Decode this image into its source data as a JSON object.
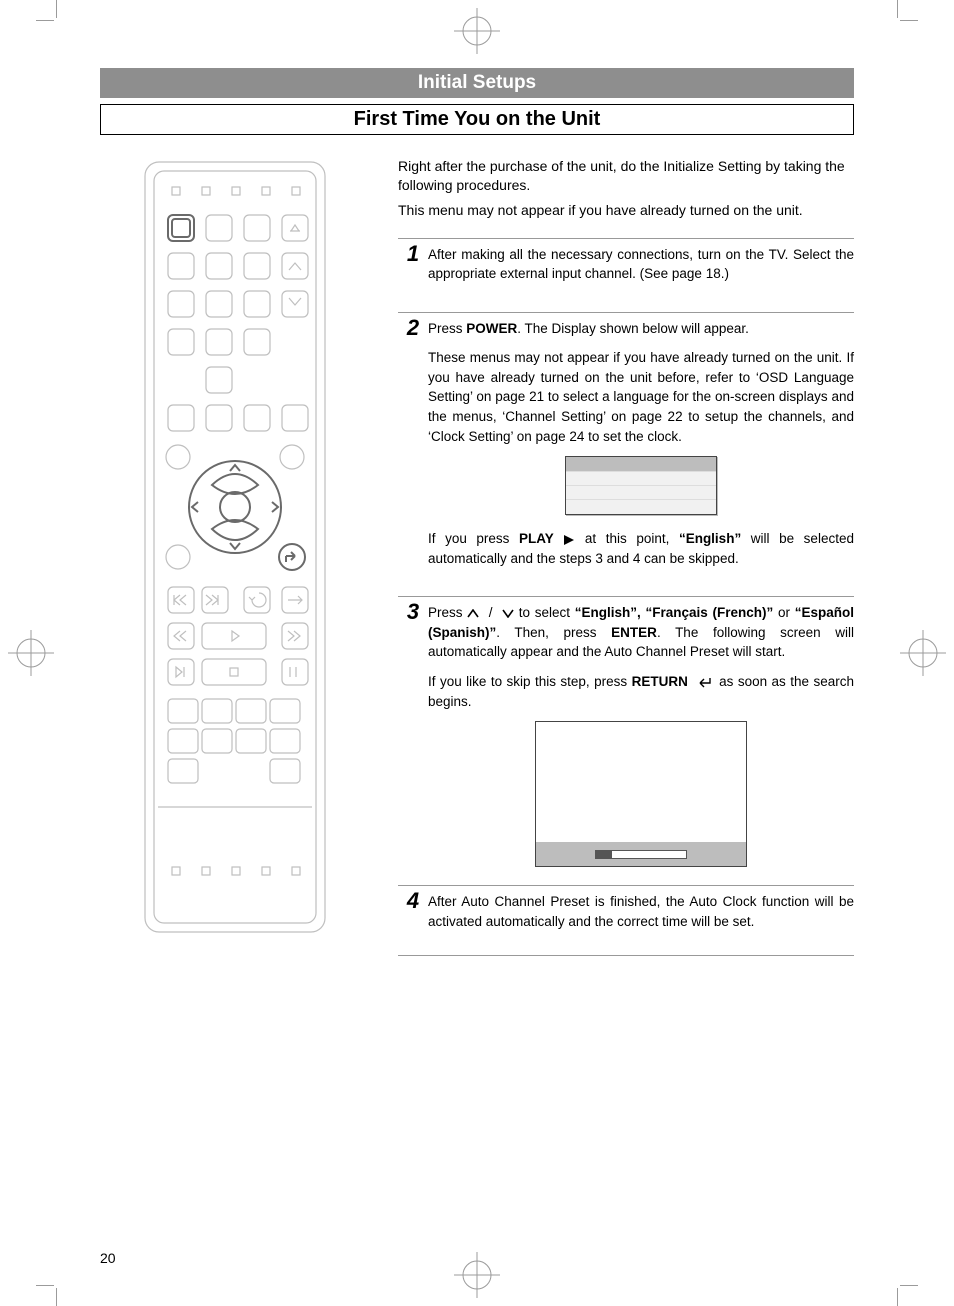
{
  "header": {
    "section": "Initial Setups",
    "title": "First Time You on the Unit"
  },
  "intro": {
    "p1": "Right after the purchase of the unit, do the Initialize Setting by taking the following procedures.",
    "p2": "This menu may not appear if you have already turned on the unit."
  },
  "steps": {
    "s1": {
      "num": "1",
      "text": "After making all the necessary connections, turn on the TV.  Select the appropriate external input channel.  (See page 18.)"
    },
    "s2": {
      "num": "2",
      "lead_a": "Press ",
      "power": "POWER",
      "lead_b": ".  The Display shown below will appear.",
      "body": "These menus may not appear if you have already turned on the unit.  If you have already turned on the unit before, refer to ‘OSD Language Setting’ on page 21 to select a language for the on-screen displays and the menus, ‘Channel Setting’ on page 22 to setup the channels, and ‘Clock Setting’ on page 24 to set the clock.",
      "after_a": "If you press ",
      "play": "PLAY",
      "after_b": " at this point, ",
      "english": "“English”",
      "after_c": " will be selected automatically and the steps 3 and 4 can be skipped."
    },
    "s3": {
      "num": "3",
      "lead_a": "Press ",
      "lead_b": " to select ",
      "opt1": "“English”, “Français (French)”",
      "or": " or ",
      "opt2": "“Español (Spanish)”",
      "then": ".  Then, press ",
      "enter": "ENTER",
      "tail": ". The following screen will automatically appear and the Auto Channel Preset will start.",
      "skip_a": "If you like to skip this step, press ",
      "return": "RETURN",
      "skip_b": "  as soon as the search begins."
    },
    "s4": {
      "num": "4",
      "text": " After Auto Channel Preset is finished, the Auto Clock function will be activated automatically and the correct time will be set."
    }
  },
  "page_number": "20"
}
